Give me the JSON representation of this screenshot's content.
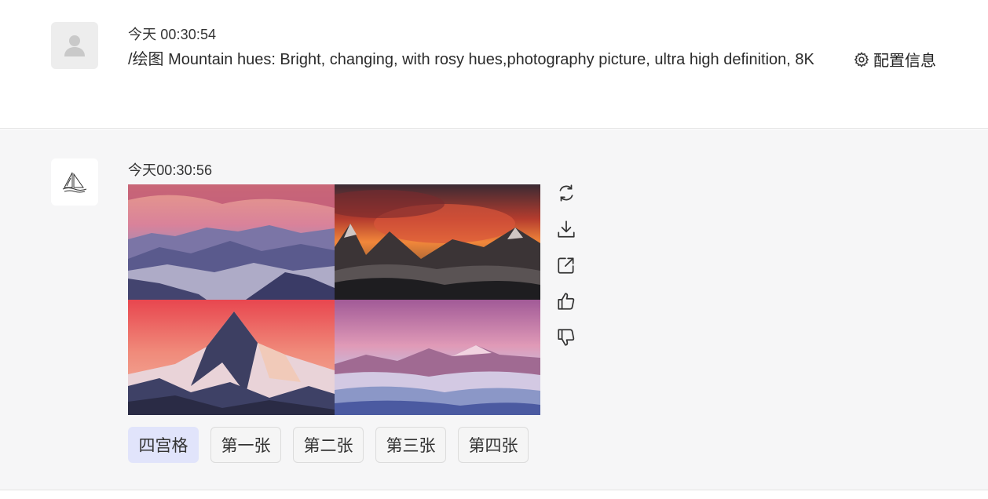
{
  "user_message": {
    "timestamp": "今天 00:30:54",
    "prompt": "/绘图 Mountain hues: Bright, changing, with rosy hues,photography picture, ultra high definition, 8K",
    "config_label": "配置信息",
    "avatar_icon": "user-silhouette-icon",
    "config_icon": "gear-icon"
  },
  "bot_message": {
    "timestamp": "今天00:30:56",
    "avatar_icon": "sailboat-logo-icon",
    "images": [
      {
        "name": "image-1",
        "description_icon": "mountain-image"
      },
      {
        "name": "image-2",
        "description_icon": "mountain-image"
      },
      {
        "name": "image-3",
        "description_icon": "mountain-image"
      },
      {
        "name": "image-4",
        "description_icon": "mountain-image"
      }
    ],
    "actions": [
      "refresh-icon",
      "download-icon",
      "share-icon",
      "thumbs-up-icon",
      "thumbs-down-icon"
    ],
    "buttons": [
      "四宫格",
      "第一张",
      "第二张",
      "第三张",
      "第四张"
    ],
    "active_button": "四宫格"
  },
  "colors": {
    "active_button_bg": "#e1e4fb",
    "bot_bg": "#f6f6f7"
  }
}
